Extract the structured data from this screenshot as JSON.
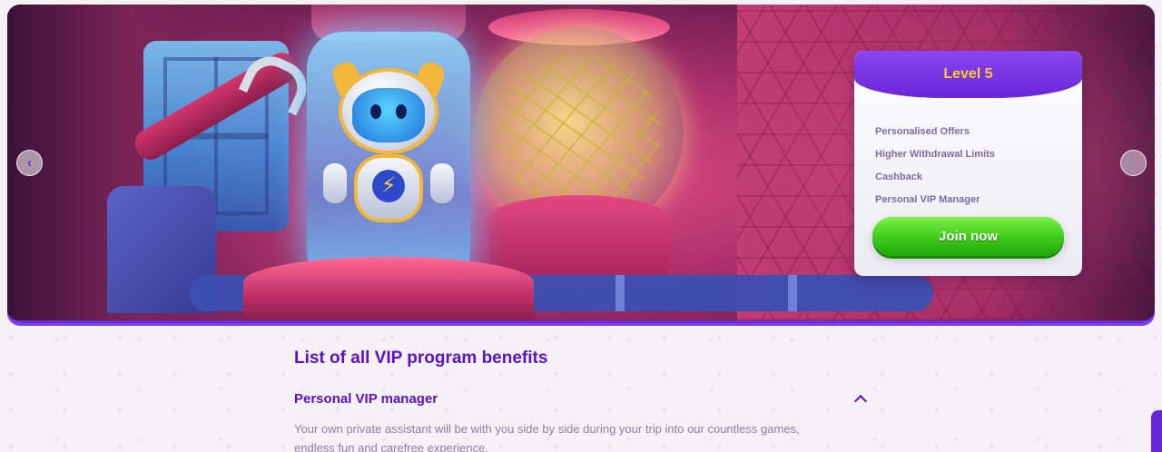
{
  "banner": {
    "prev_icon": "chevron-left-icon",
    "next_icon": "chevron-right-icon",
    "prev_glyph": "‹",
    "next_glyph": "›",
    "level_card": {
      "title": "Level 5",
      "benefits": [
        "Personalised Offers",
        "Higher Withdrawal Limits",
        "Cashback",
        "Personal VIP Manager"
      ],
      "cta_label": "Join now"
    },
    "robot_bolt": "⚡"
  },
  "content": {
    "section_title": "List of all VIP program benefits",
    "accordion": {
      "title": "Personal VIP manager",
      "expanded": true,
      "body": "Your own private assistant will be with you side by side during your trip into our countless games, endless fun and carefree experience."
    }
  },
  "colors": {
    "accent_purple": "#5a12c9",
    "level_gold": "#ffcb2d",
    "cta_green": "#3ec81a"
  }
}
